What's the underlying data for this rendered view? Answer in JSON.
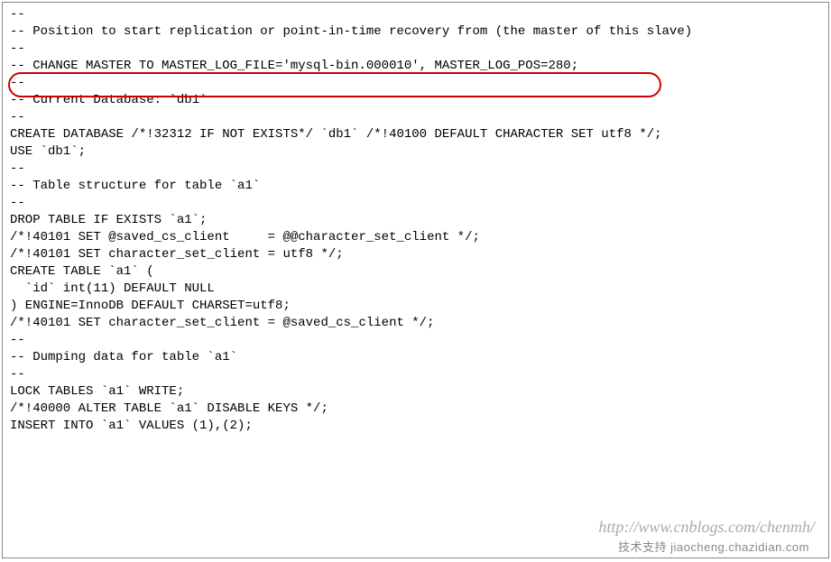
{
  "lines": [
    "--",
    "-- Position to start replication or point-in-time recovery from (the master of this slave)",
    "--",
    "",
    "-- CHANGE MASTER TO MASTER_LOG_FILE='mysql-bin.000010', MASTER_LOG_POS=280;",
    "",
    "--",
    "-- Current Database: `db1`",
    "--",
    "",
    "CREATE DATABASE /*!32312 IF NOT EXISTS*/ `db1` /*!40100 DEFAULT CHARACTER SET utf8 */;",
    "",
    "USE `db1`;",
    "",
    "--",
    "-- Table structure for table `a1`",
    "--",
    "",
    "DROP TABLE IF EXISTS `a1`;",
    "/*!40101 SET @saved_cs_client     = @@character_set_client */;",
    "/*!40101 SET character_set_client = utf8 */;",
    "CREATE TABLE `a1` (",
    "  `id` int(11) DEFAULT NULL",
    ") ENGINE=InnoDB DEFAULT CHARSET=utf8;",
    "/*!40101 SET character_set_client = @saved_cs_client */;",
    "",
    "--",
    "-- Dumping data for table `a1`",
    "--",
    "",
    "LOCK TABLES `a1` WRITE;",
    "/*!40000 ALTER TABLE `a1` DISABLE KEYS */;",
    "INSERT INTO `a1` VALUES (1),(2);"
  ],
  "watermark_url": "http://www.cnblogs.com/chenmh/",
  "watermark_text": "技术支持 jiaocheng.chazidian.com"
}
